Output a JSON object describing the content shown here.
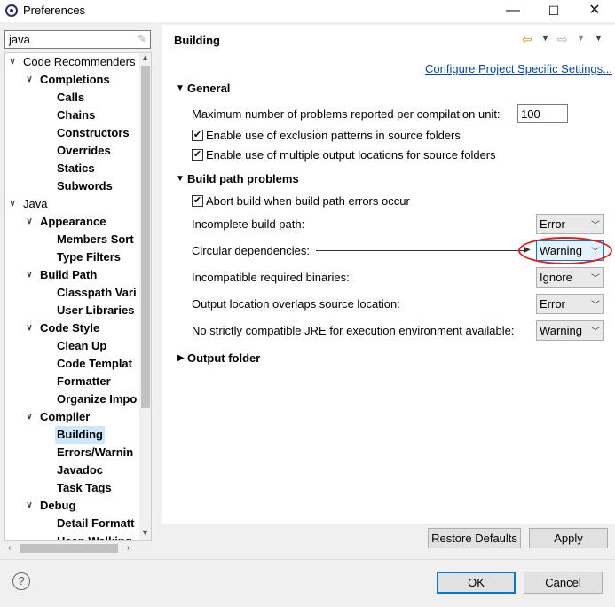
{
  "window": {
    "title": "Preferences",
    "controls": {
      "minimize": "—",
      "maximize": "☐",
      "close": "✕"
    }
  },
  "filter": {
    "value": "java",
    "clear_icon": "clear-icon"
  },
  "tree": [
    {
      "label": "Code Recommenders",
      "level": 0,
      "twisty": "v"
    },
    {
      "label": "Completions",
      "level": 1,
      "twisty": "v"
    },
    {
      "label": "Calls",
      "level": 2
    },
    {
      "label": "Chains",
      "level": 2
    },
    {
      "label": "Constructors",
      "level": 2
    },
    {
      "label": "Overrides",
      "level": 2
    },
    {
      "label": "Statics",
      "level": 2
    },
    {
      "label": "Subwords",
      "level": 2
    },
    {
      "label": "Java",
      "level": 0,
      "twisty": "v"
    },
    {
      "label": "Appearance",
      "level": 1,
      "twisty": "v"
    },
    {
      "label": "Members Sort",
      "level": 2
    },
    {
      "label": "Type Filters",
      "level": 2
    },
    {
      "label": "Build Path",
      "level": 1,
      "twisty": "v"
    },
    {
      "label": "Classpath Vari",
      "level": 2
    },
    {
      "label": "User Libraries",
      "level": 2
    },
    {
      "label": "Code Style",
      "level": 1,
      "twisty": "v"
    },
    {
      "label": "Clean Up",
      "level": 2
    },
    {
      "label": "Code Templat",
      "level": 2
    },
    {
      "label": "Formatter",
      "level": 2
    },
    {
      "label": "Organize Impo",
      "level": 2
    },
    {
      "label": "Compiler",
      "level": 1,
      "twisty": "v"
    },
    {
      "label": "Building",
      "level": 2,
      "selected": true
    },
    {
      "label": "Errors/Warnin",
      "level": 2
    },
    {
      "label": "Javadoc",
      "level": 2
    },
    {
      "label": "Task Tags",
      "level": 2
    },
    {
      "label": "Debug",
      "level": 1,
      "twisty": "v"
    },
    {
      "label": "Detail Formatt",
      "level": 2
    },
    {
      "label": "Heap Walking",
      "level": 2
    }
  ],
  "page": {
    "title": "Building",
    "configure_link": "Configure Project Specific Settings...",
    "general": {
      "heading": "General",
      "max_problems_label": "Maximum number of problems reported per compilation unit:",
      "max_problems_value": "100",
      "exclusion_label": "Enable use of exclusion patterns in source folders",
      "multiple_output_label": "Enable use of multiple output locations for source folders"
    },
    "build_path": {
      "heading": "Build path problems",
      "abort_label": "Abort build when build path errors occur",
      "rows": [
        {
          "label": "Incomplete build path:",
          "value": "Error"
        },
        {
          "label": "Circular dependencies:",
          "value": "Warning"
        },
        {
          "label": "Incompatible required binaries:",
          "value": "Ignore"
        },
        {
          "label": "Output location overlaps source location:",
          "value": "Error"
        },
        {
          "label": "No strictly compatible JRE for execution environment available:",
          "value": "Warning"
        }
      ]
    },
    "output_folder": {
      "heading": "Output folder"
    },
    "restore_defaults": "Restore Defaults",
    "apply": "Apply"
  },
  "footer": {
    "help_icon": "?",
    "ok": "OK",
    "cancel": "Cancel"
  },
  "colors": {
    "accent": "#0078d7",
    "annotation": "#e02020",
    "selection": "#cce8ff"
  }
}
